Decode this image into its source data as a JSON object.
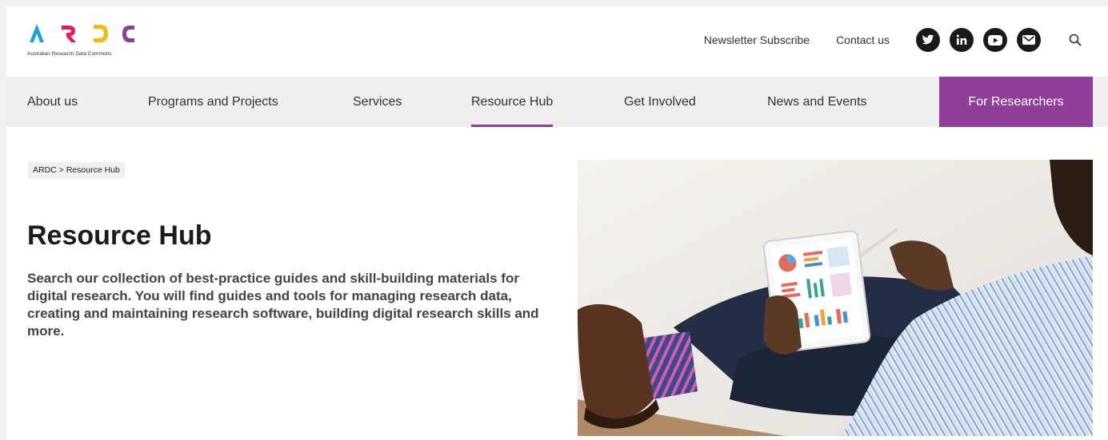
{
  "header": {
    "logo_text": "ARDC",
    "logo_tagline": "Australian Research Data Commons",
    "newsletter_label": "Newsletter Subscribe",
    "contact_label": "Contact us",
    "social_icons": [
      "twitter-icon",
      "linkedin-icon",
      "youtube-icon",
      "email-icon"
    ],
    "search_icon": "search-icon"
  },
  "nav": {
    "items": [
      {
        "label": "About us"
      },
      {
        "label": "Programs and Projects"
      },
      {
        "label": "Services"
      },
      {
        "label": "Resource Hub",
        "active": true
      },
      {
        "label": "Get Involved"
      },
      {
        "label": "News and Events"
      }
    ],
    "cta_label": "For Researchers"
  },
  "breadcrumb": "ARDC > Resource Hub",
  "page": {
    "title": "Resource Hub",
    "intro": "Search our collection of best-practice guides and skill-building materials for digital research. You will find guides and tools for managing research data, creating and maintaining research software, building digital research skills and more."
  },
  "colors": {
    "brand_purple": "#8f3f97",
    "logo_a": "#1ba3d6",
    "logo_r": "#e7195e",
    "logo_d": "#fbb316",
    "logo_c": "#8f3f97"
  }
}
